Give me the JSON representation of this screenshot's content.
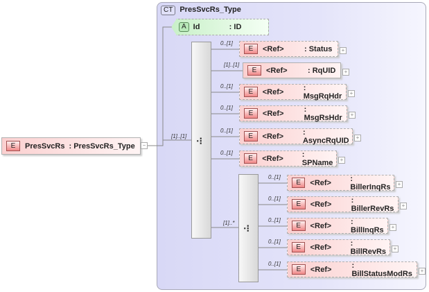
{
  "root": {
    "badge": "E",
    "name": "PresSvcRs",
    "type": ": PresSvcRs_Type",
    "occurrence": "[1]..[1]"
  },
  "complex_type": {
    "badge": "CT",
    "name": "PresSvcRs_Type"
  },
  "attribute": {
    "badge": "A",
    "name": "Id",
    "type": ": ID"
  },
  "sequence1": {
    "children": [
      {
        "badge": "E",
        "ref": "<Ref>",
        "type": ": Status",
        "occurrence": "0..[1]",
        "optional": true
      },
      {
        "badge": "E",
        "ref": "<Ref>",
        "type": ": RqUID",
        "occurrence": "[1]..[1]",
        "optional": false
      },
      {
        "badge": "E",
        "ref": "<Ref>",
        "type": ": MsgRqHdr",
        "occurrence": "0..[1]",
        "optional": true
      },
      {
        "badge": "E",
        "ref": "<Ref>",
        "type": ": MsgRsHdr",
        "occurrence": "0..[1]",
        "optional": true
      },
      {
        "badge": "E",
        "ref": "<Ref>",
        "type": ": AsyncRqUID",
        "occurrence": "0..[1]",
        "optional": true
      },
      {
        "badge": "E",
        "ref": "<Ref>",
        "type": ": SPName",
        "occurrence": "0..[1]",
        "optional": true
      }
    ]
  },
  "sequence2": {
    "occurrence": "[1]..*",
    "children": [
      {
        "badge": "E",
        "ref": "<Ref>",
        "type": ": BillerInqRs",
        "occurrence": "0..[1]",
        "optional": true
      },
      {
        "badge": "E",
        "ref": "<Ref>",
        "type": ": BillerRevRs",
        "occurrence": "0..[1]",
        "optional": true
      },
      {
        "badge": "E",
        "ref": "<Ref>",
        "type": ": BillInqRs",
        "occurrence": "0..[1]",
        "optional": true
      },
      {
        "badge": "E",
        "ref": "<Ref>",
        "type": ": BillRevRs",
        "occurrence": "0..[1]",
        "optional": true
      },
      {
        "badge": "E",
        "ref": "<Ref>",
        "type": ": BillStatusModRs",
        "occurrence": "0..[1]",
        "optional": true
      }
    ]
  }
}
